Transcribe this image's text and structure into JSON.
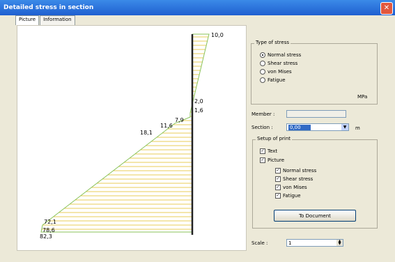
{
  "window": {
    "title": "Detailed stress in section"
  },
  "tabs": [
    {
      "label": "Picture"
    },
    {
      "label": "Information"
    }
  ],
  "diagram": {
    "labels": [
      "10,0",
      "2,0",
      "1,6",
      "7,9",
      "11,6",
      "18,1",
      "72,1",
      "78,6",
      "82,3"
    ]
  },
  "type_of_stress": {
    "title": "Type of stress",
    "options": [
      {
        "label": "Normal stress",
        "selected": true
      },
      {
        "label": "Shear stress",
        "selected": false
      },
      {
        "label": "von Mises",
        "selected": false
      },
      {
        "label": "Fatigue",
        "selected": false
      }
    ],
    "unit": "MPa"
  },
  "member": {
    "label": "Member :",
    "value": ""
  },
  "section": {
    "label": "Section :",
    "value": "0,00",
    "unit": "m"
  },
  "setup": {
    "title": "Setup of print",
    "text_label": "Text",
    "text_checked": true,
    "picture_label": "Picture",
    "picture_checked": true,
    "sub": [
      {
        "label": "Normal stress",
        "checked": true
      },
      {
        "label": "Shear stress",
        "checked": true
      },
      {
        "label": "von Mises",
        "checked": true
      },
      {
        "label": "Fatigue",
        "checked": true
      }
    ],
    "button_label": "To Document"
  },
  "scale": {
    "label": "Scale :",
    "value": "1"
  }
}
